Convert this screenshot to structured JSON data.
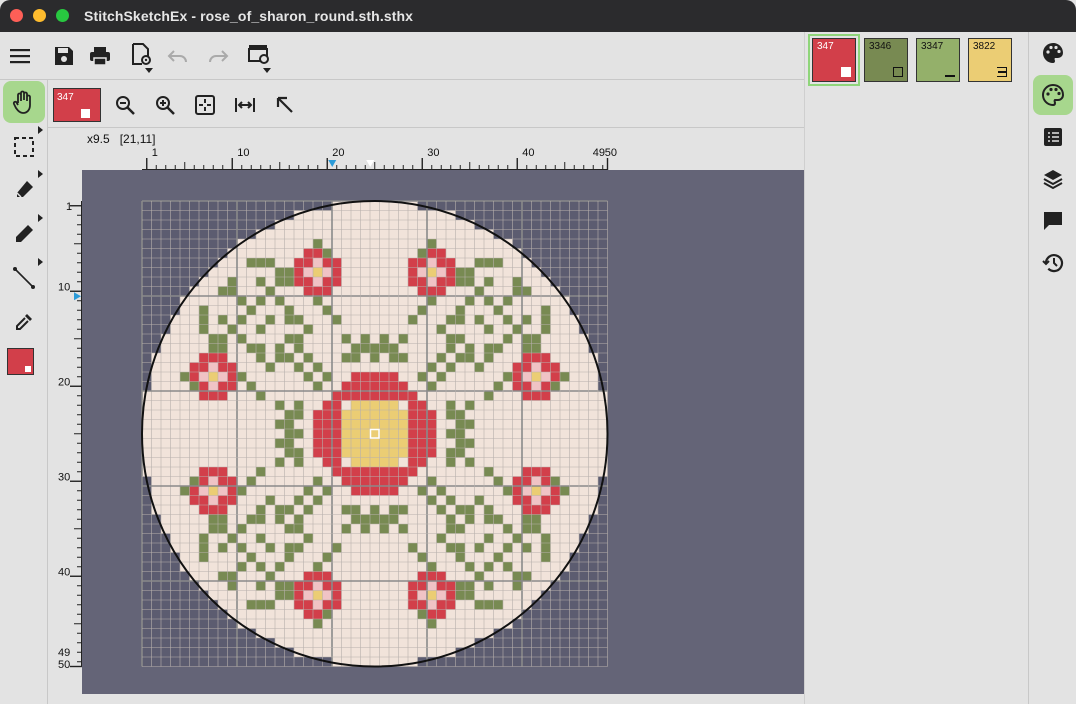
{
  "window": {
    "title": "StitchSketchEx - rose_of_sharon_round.sth.sthx"
  },
  "colors": {
    "red": "#d23f4a",
    "green": "#788a52",
    "lightgreen": "#94b06a",
    "yellow": "#ebcd74",
    "fabric": "#f1e3da",
    "canvas_bg": "#646477",
    "active_tool": "#a7d78d"
  },
  "toolbar": {
    "icons": [
      "menu-icon",
      "save-icon",
      "print-icon",
      "document-settings-icon",
      "undo-icon",
      "redo-icon",
      "film-settings-icon"
    ]
  },
  "current_color": {
    "code": "347"
  },
  "view_toolbar": {
    "icons": [
      "zoom-out-icon",
      "zoom-in-icon",
      "fit-icon",
      "fit-width-icon",
      "pointer-icon"
    ]
  },
  "status": {
    "zoom": "x9.5",
    "coords": "[21,11]"
  },
  "ruler": {
    "h_labels": [
      "1",
      "10",
      "20",
      "30",
      "40",
      "49",
      "50"
    ],
    "v_labels": [
      "1",
      "10",
      "20",
      "30",
      "40",
      "49",
      "50"
    ]
  },
  "palette": [
    {
      "code": "347",
      "color": "#d23f4a",
      "symbol": "filled-square",
      "selected": true
    },
    {
      "code": "3346",
      "color": "#788a52",
      "symbol": "hollow-square",
      "selected": false
    },
    {
      "code": "3347",
      "color": "#94b06a",
      "symbol": "dash",
      "selected": false
    },
    {
      "code": "3822",
      "color": "#ebcd74",
      "symbol": "e-shape",
      "selected": false
    }
  ],
  "pattern": {
    "grid_size": 49,
    "center": [
      25,
      25
    ],
    "radius": 24.5,
    "cursor": [
      25,
      25
    ]
  }
}
